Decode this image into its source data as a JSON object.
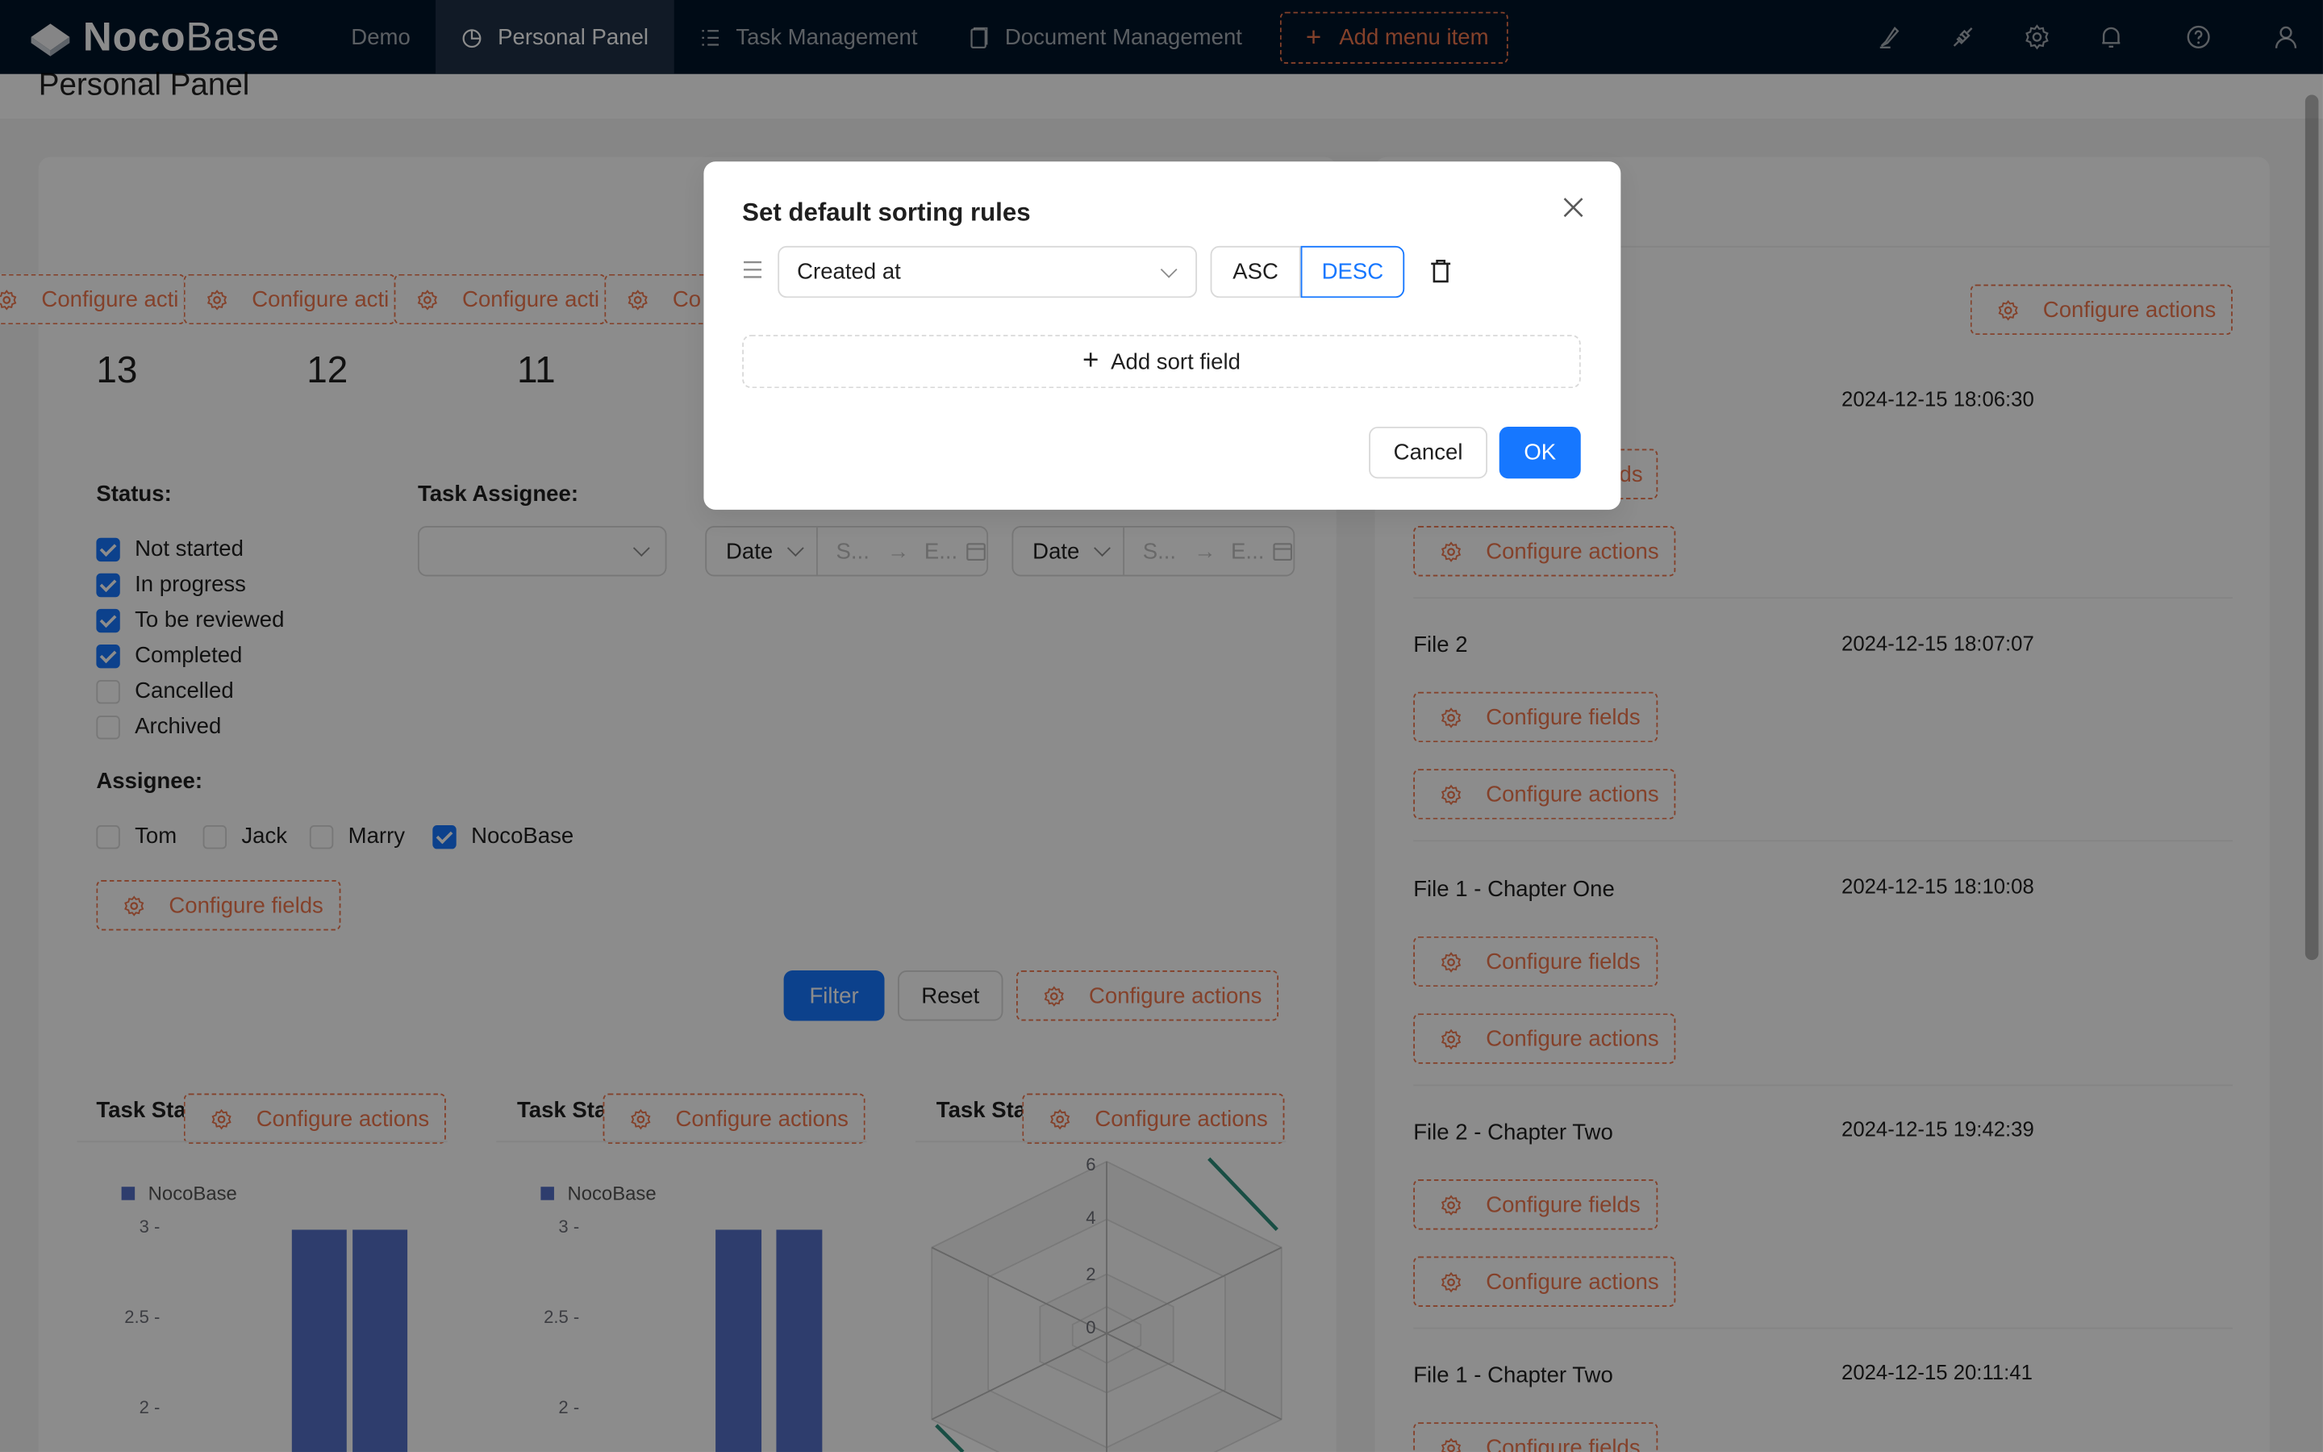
{
  "app": {
    "logo_bold": "Noco",
    "logo_light": "Base",
    "nav": [
      {
        "label": "Demo",
        "icon": ""
      },
      {
        "label": "Personal Panel",
        "icon": "pie-chart-icon"
      },
      {
        "label": "Task Management",
        "icon": "list-icon"
      },
      {
        "label": "Document Management",
        "icon": "file-icon"
      }
    ],
    "add_menu_label": "Add menu item",
    "right_icons": [
      "highlight-icon",
      "plugin-icon",
      "settings-icon",
      "bell-icon",
      "help-icon",
      "user-icon"
    ]
  },
  "page": {
    "title": "Personal Panel"
  },
  "left": {
    "configure_actions": "Configure actions",
    "configure_actions_truncated": "Configure acti",
    "configure_actions_truncated_short": "Co",
    "stats": [
      "13",
      "12",
      "11"
    ],
    "filter": {
      "status_label": "Status:",
      "assignee_field_label": "Task Assignee:",
      "statuses": [
        {
          "label": "Not started",
          "checked": true
        },
        {
          "label": "In progress",
          "checked": true
        },
        {
          "label": "To be reviewed",
          "checked": true
        },
        {
          "label": "Completed",
          "checked": true
        },
        {
          "label": "Cancelled",
          "checked": false
        },
        {
          "label": "Archived",
          "checked": false
        }
      ],
      "assignee_label": "Assignee:",
      "assignees": [
        {
          "label": "Tom",
          "checked": false
        },
        {
          "label": "Jack",
          "checked": false
        },
        {
          "label": "Marry",
          "checked": false
        },
        {
          "label": "NocoBase",
          "checked": true
        }
      ],
      "date_picker_1": {
        "type": "Date",
        "start": "S...",
        "end": "E..."
      },
      "date_picker_2": {
        "type": "Date",
        "start": "S...",
        "end": "E..."
      },
      "configure_fields": "Configure fields",
      "filter_button": "Filter",
      "reset_button": "Reset"
    },
    "charts": [
      {
        "title": "Task Stat",
        "legend": "NocoBase"
      },
      {
        "title": "Task Stat",
        "legend": "NocoBase"
      },
      {
        "title": "Task Stat",
        "legend": ""
      }
    ],
    "bar_ticks": [
      "3 -",
      "2.5 -",
      "2 -"
    ],
    "radar_ticks": [
      "6",
      "4",
      "2",
      "0"
    ]
  },
  "chart_data": [
    {
      "type": "bar",
      "series": [
        {
          "name": "NocoBase",
          "values": [
            3,
            3
          ]
        }
      ],
      "yticks": [
        2,
        2.5,
        3
      ]
    },
    {
      "type": "bar",
      "series": [
        {
          "name": "NocoBase",
          "values": [
            3,
            3
          ]
        }
      ],
      "yticks": [
        2,
        2.5,
        3
      ]
    }
  ],
  "right": {
    "configure_actions": "Configure actions",
    "configure_fields": "Configure fields",
    "configure_fields_truncated": "ds",
    "files": [
      {
        "name": "",
        "date": "2024-12-15 18:06:30"
      },
      {
        "name": "File 2",
        "date": "2024-12-15 18:07:07"
      },
      {
        "name": "File 1 - Chapter One",
        "date": "2024-12-15 18:10:08"
      },
      {
        "name": "File 2 - Chapter Two",
        "date": "2024-12-15 19:42:39"
      },
      {
        "name": "File 1 - Chapter Two",
        "date": "2024-12-15 20:11:41"
      }
    ]
  },
  "modal": {
    "title": "Set default sorting rules",
    "field_value": "Created at",
    "asc_label": "ASC",
    "desc_label": "DESC",
    "selected_order": "DESC",
    "add_sort_label": "Add sort field",
    "cancel_label": "Cancel",
    "ok_label": "OK",
    "primary_color": "#1677ff",
    "accent_color": "#f0774e"
  }
}
